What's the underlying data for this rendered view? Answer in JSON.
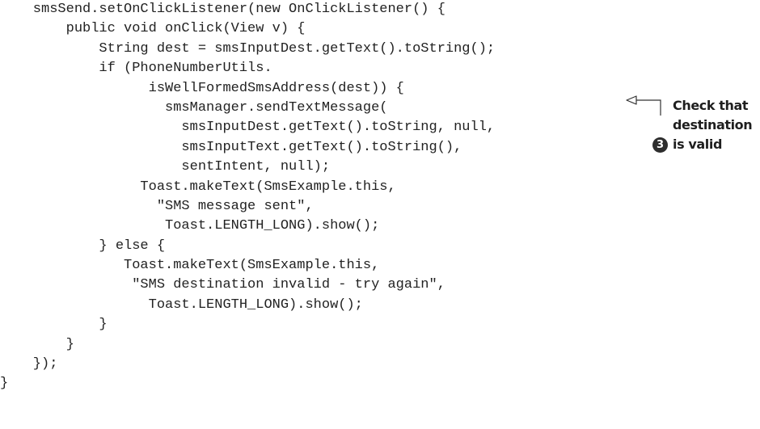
{
  "code": {
    "lines": [
      "    smsSend.setOnClickListener(new OnClickListener() {",
      "        public void onClick(View v) {",
      "            String dest = smsInputDest.getText().toString();",
      "            if (PhoneNumberUtils.",
      "                  isWellFormedSmsAddress(dest)) {",
      "                    smsManager.sendTextMessage(",
      "                      smsInputDest.getText().toString, null,",
      "                      smsInputText.getText().toString(),",
      "                      sentIntent, null);",
      "                 Toast.makeText(SmsExample.this,",
      "                   \"SMS message sent\",",
      "                    Toast.LENGTH_LONG).show();",
      "            } else {",
      "               Toast.makeText(SmsExample.this,",
      "                \"SMS destination invalid - try again\",",
      "                  Toast.LENGTH_LONG).show();",
      "            }",
      "        }",
      "    });",
      "}"
    ]
  },
  "annotation": {
    "number": "3",
    "lines": [
      "Check that",
      "destination",
      "is valid"
    ]
  }
}
